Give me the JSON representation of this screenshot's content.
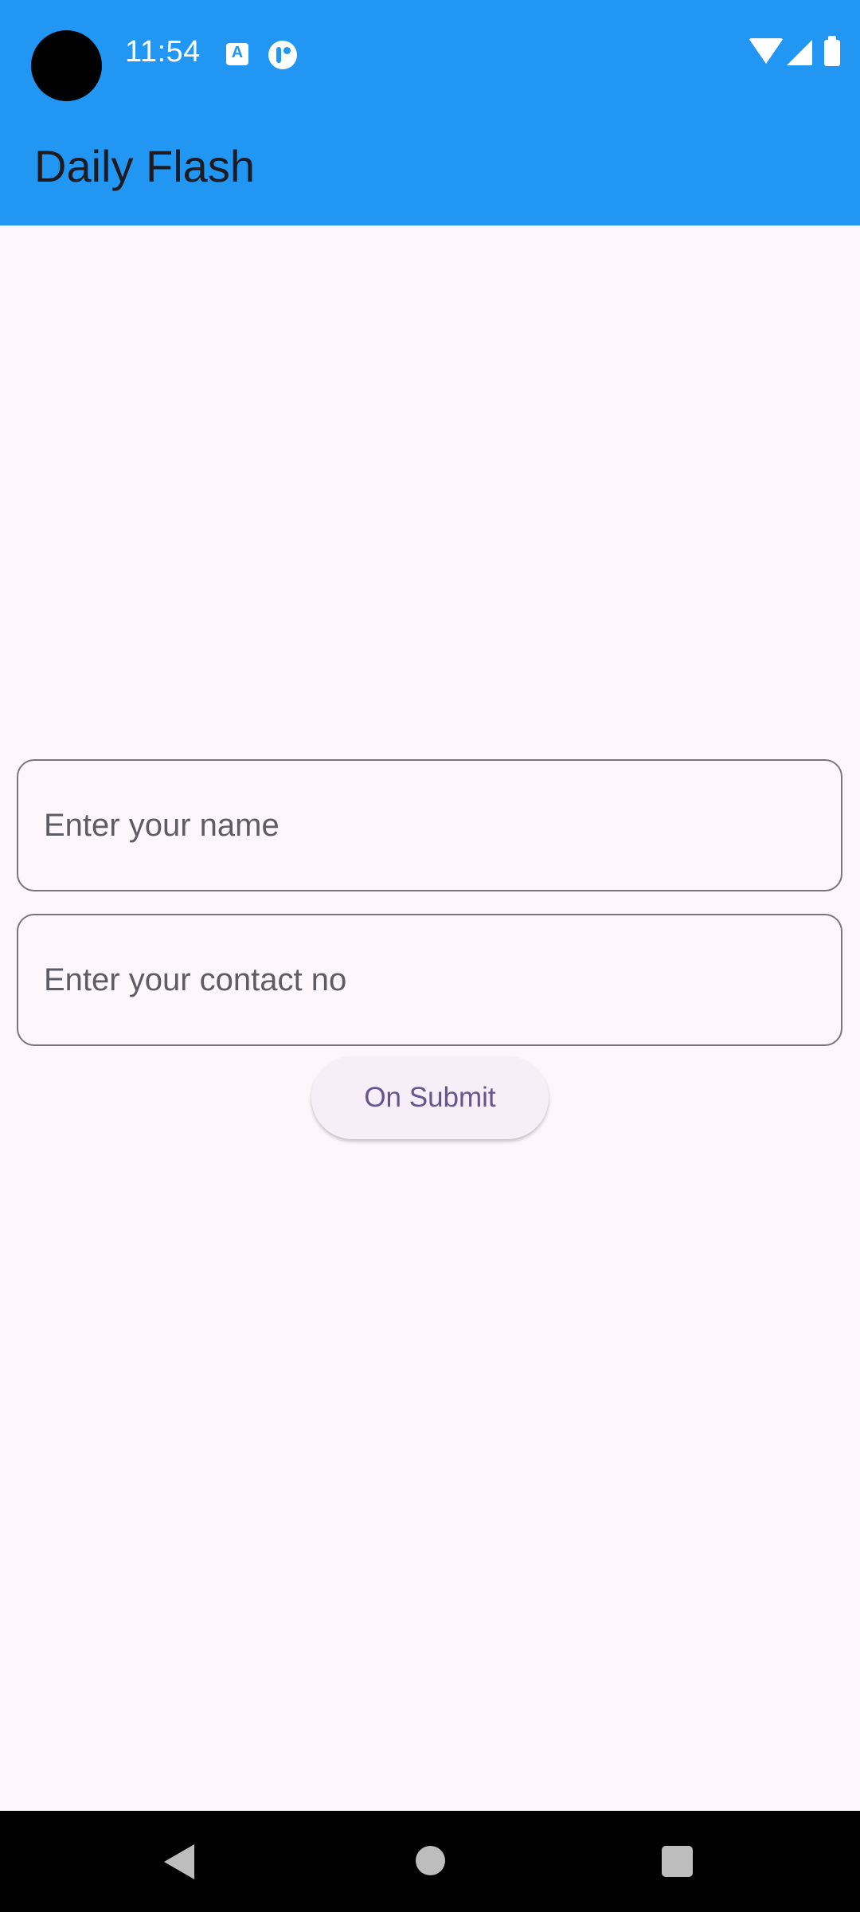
{
  "status_bar": {
    "time": "11:54",
    "notification_icons": [
      "a-icon",
      "app-notification-icon"
    ],
    "system_icons": [
      "wifi-icon",
      "signal-icon",
      "battery-icon"
    ]
  },
  "app_bar": {
    "title": "Daily Flash",
    "color": "#2196F3"
  },
  "form": {
    "name_field": {
      "placeholder": "Enter your name",
      "value": ""
    },
    "contact_field": {
      "placeholder": "Enter your contact no",
      "value": ""
    },
    "submit_label": "On Submit"
  },
  "nav_bar": {
    "buttons": [
      "back-icon",
      "home-icon",
      "recents-icon"
    ]
  },
  "colors": {
    "background": "#FDF7FD",
    "outline": "#79747E",
    "button_text": "#65558F",
    "button_bg": "#F6EFF7"
  }
}
